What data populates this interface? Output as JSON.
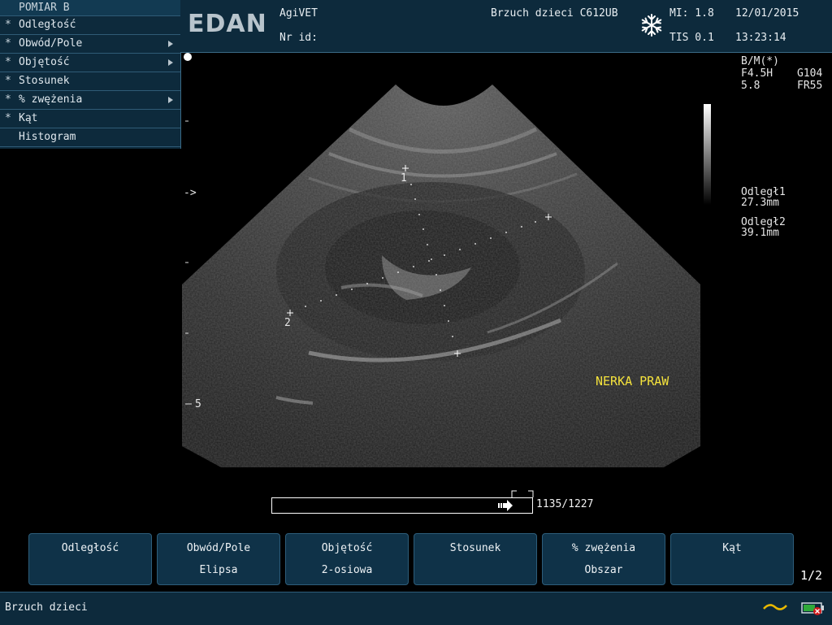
{
  "menu": {
    "title": "POMIAR B",
    "items": [
      {
        "label": "Odległość",
        "star": "*",
        "submenu": false
      },
      {
        "label": "Obwód/Pole",
        "star": "*",
        "submenu": true
      },
      {
        "label": "Objętość",
        "star": "*",
        "submenu": true
      },
      {
        "label": "Stosunek",
        "star": "*",
        "submenu": false
      },
      {
        "label": "% zwężenia",
        "star": "*",
        "submenu": true
      },
      {
        "label": "Kąt",
        "star": "*",
        "submenu": false
      },
      {
        "label": "Histogram",
        "star": "",
        "submenu": false
      }
    ]
  },
  "header": {
    "logo": "EDAN",
    "hospital": "AgiVET",
    "patient_id_label": "Nr id:",
    "exam": "Brzuch dzieci C612UB",
    "freeze_icon": "snowflake-icon",
    "mi": "MI: 1.8",
    "tis": "TIS 0.1",
    "date": "12/01/2015",
    "time": "13:23:14"
  },
  "params": {
    "mode": "B/M(*)",
    "freq": "F4.5H",
    "gain": "G104",
    "depth": "5.8",
    "frame_rate": "FR55"
  },
  "measurements": [
    {
      "label": "Odległ1",
      "value": "27.3mm"
    },
    {
      "label": "Odległ2",
      "value": "39.1mm"
    }
  ],
  "annotation": "NERKA PRAW",
  "caliper_labels": {
    "one": "1",
    "two": "2"
  },
  "depth_scale": {
    "focus_marker": "->",
    "depth_label": "5"
  },
  "cine": {
    "counter": "1135/1227",
    "position": 0.925
  },
  "softkeys": [
    {
      "line1": "Odległość",
      "line2": ""
    },
    {
      "line1": "Obwód/Pole",
      "line2": "Elipsa"
    },
    {
      "line1": "Objętość",
      "line2": "2-osiowa"
    },
    {
      "line1": "Stosunek",
      "line2": ""
    },
    {
      "line1": "% zwężenia",
      "line2": "Obszar"
    },
    {
      "line1": "Kąt",
      "line2": ""
    }
  ],
  "page_indicator": "1/2",
  "status": {
    "preset": "Brzuch dzieci",
    "power_icon": "ac-power-icon",
    "battery_icon": "battery-icon"
  },
  "colors": {
    "panel": "#0d2a3c",
    "annotation": "#f4e23c"
  }
}
